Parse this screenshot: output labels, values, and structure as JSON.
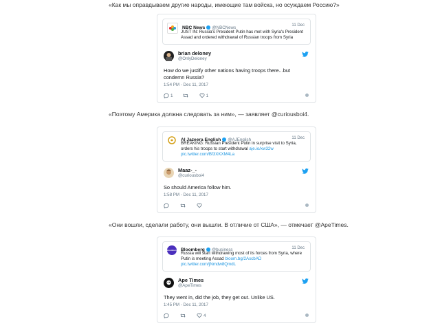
{
  "colors": {
    "link": "#1b95e0",
    "verified": "#1da1f2",
    "muted": "#657786"
  },
  "sections": [
    {
      "caption": "«Как мы оправдываем другие народы, имеющие там войска, но осуждаем Россию?»",
      "quote": {
        "name": "NBC News",
        "handle": "@NBCNews",
        "date": "11 Dec",
        "text": "JUST IN: Russia's President Putin has met with Syria's President Assad and ordered withdrawal of Russian troops from Syria",
        "link": "",
        "link2": "",
        "logo_icon": "nbc-peacock-icon"
      },
      "tweet": {
        "name": "brian deloney",
        "handle": "@OnlyDeloney",
        "text": "How do we justify other nations having troops there...but condemn Russia?",
        "time": "1:54 PM - Dec 11, 2017",
        "replies": "1",
        "retweets": "",
        "likes": "1"
      }
    },
    {
      "caption": "«Поэтому Америка должна следовать за ним», — заявляет @curiousboi4.",
      "quote": {
        "name": "Al Jazeera English",
        "handle": "@AJEnglish",
        "date": "11 Dec",
        "text": "BREAKING: Russian President Putin in surprise visit to Syria, orders his troops to start withdrawal",
        "link": "aje.io/xw32w",
        "link2": "pic.twitter.com/Bf3XKXM4La",
        "logo_icon": "al-jazeera-icon"
      },
      "tweet": {
        "name": "Maaz-_-",
        "handle": "@curiousboi4",
        "text": "So should America follow him.",
        "time": "1:58 PM - Dec 11, 2017",
        "replies": "",
        "retweets": "",
        "likes": ""
      }
    },
    {
      "caption": "«Они вошли, сделали работу, они вышли. В отличие от США», — отмечает @ApeTimes.",
      "quote": {
        "name": "Bloomberg",
        "handle": "@business",
        "date": "11 Dec",
        "text": "Russia will start withdrawing most of its forces from Syria, where Putin is meeting Assad",
        "link": "bloom.bg/2AscbAD",
        "link2": "pic.twitter.com/jNmdw8QmdL",
        "logo_icon": "bloomberg-icon"
      },
      "tweet": {
        "name": "Ape Times",
        "handle": "@ApeTimes",
        "text": "They went in, did the job, they get out. Unlike US.",
        "time": "1:45 PM - Dec 11, 2017",
        "replies": "",
        "retweets": "",
        "likes": "4"
      }
    }
  ]
}
